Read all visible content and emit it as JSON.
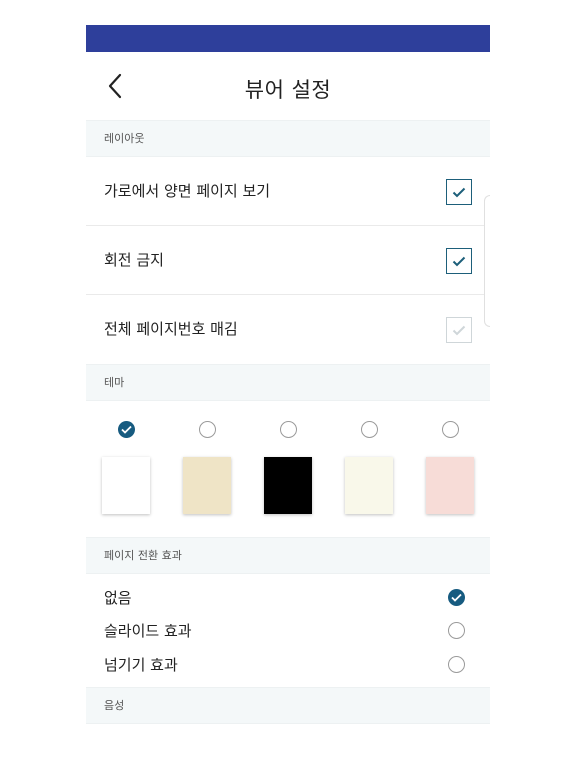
{
  "colors": {
    "statusbar": "#2e3f9b",
    "accent": "#175b80",
    "checkbox_border": "#1d5f7a",
    "section_bg": "#f4f8f9"
  },
  "header": {
    "title": "뷰어 설정",
    "back_icon": "chevron-left-icon"
  },
  "layout_section": {
    "title": "레이아웃",
    "options": [
      {
        "label": "가로에서 양면 페이지 보기",
        "checked": true,
        "enabled": true
      },
      {
        "label": "회전 금지",
        "checked": true,
        "enabled": true
      },
      {
        "label": "전체 페이지번호 매김",
        "checked": true,
        "enabled": false
      }
    ]
  },
  "theme_section": {
    "title": "테마",
    "selected_index": 0,
    "themes": [
      {
        "color": "#ffffff"
      },
      {
        "color": "#efe4c6"
      },
      {
        "color": "#000000"
      },
      {
        "color": "#f9f8ea"
      },
      {
        "color": "#f7dcd7"
      }
    ]
  },
  "transition_section": {
    "title": "페이지 전환 효과",
    "options": [
      {
        "label": "없음",
        "selected": true
      },
      {
        "label": "슬라이드 효과",
        "selected": false
      },
      {
        "label": "넘기기 효과",
        "selected": false
      }
    ]
  },
  "voice_section": {
    "title": "음성"
  }
}
